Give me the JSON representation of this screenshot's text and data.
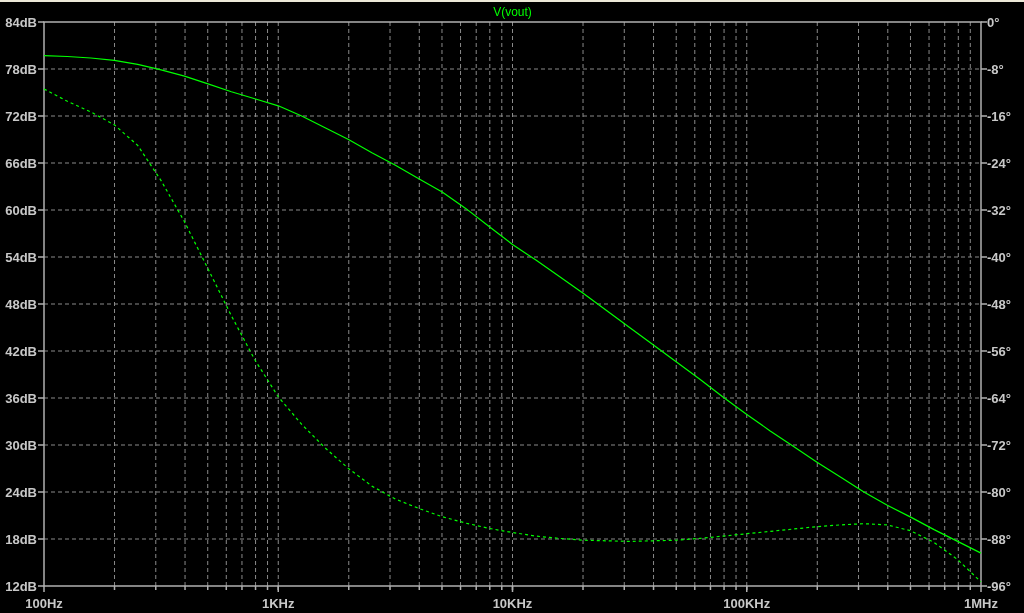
{
  "chart_data": {
    "type": "line",
    "title": "V(vout)",
    "grid": true,
    "categories": [
      "100Hz",
      null,
      null,
      null,
      null,
      null,
      null,
      null,
      null,
      null,
      "1KHz",
      null,
      null,
      null,
      null,
      null,
      null,
      null,
      null,
      null,
      "10KHz",
      null,
      null,
      null,
      null,
      null,
      null,
      null,
      null,
      null,
      "100KHz",
      null,
      null,
      null,
      null,
      null,
      null,
      null,
      null,
      null,
      "1MHz"
    ],
    "series": [
      {
        "color": "#00ff00",
        "line_style": "solid",
        "values": [
          79.7,
          79.6,
          79.4,
          79.1,
          78.6,
          77.9,
          77.1,
          76.1,
          75.1,
          74.2,
          73.3,
          72.0,
          70.5,
          69.0,
          67.3,
          65.7,
          64.0,
          62.3,
          60.2,
          57.9,
          55.6,
          53.6,
          51.5,
          49.4,
          47.2,
          45.0,
          42.8,
          40.6,
          38.4,
          36.1,
          33.9,
          31.8,
          29.8,
          27.8,
          25.9,
          24.0,
          22.3,
          20.8,
          19.2,
          17.7,
          16.2
        ]
      },
      {
        "axis": "y2",
        "color": "#00ff00",
        "line_style": "dashed",
        "values": [
          -11.4,
          -13.5,
          -15.3,
          -17.5,
          -21,
          -27,
          -34,
          -42,
          -50,
          -57.5,
          -63.8,
          -68.5,
          -72.5,
          -76,
          -79,
          -81.2,
          -82.8,
          -84.2,
          -85.3,
          -86.2,
          -86.9,
          -87.5,
          -87.9,
          -88.2,
          -88.3,
          -88.4,
          -88.3,
          -88.2,
          -87.9,
          -87.5,
          -87.1,
          -86.7,
          -86.3,
          -85.9,
          -85.6,
          -85.4,
          -85.6,
          -86.6,
          -88.6,
          -91.5,
          -95.3
        ]
      }
    ],
    "ylim": [
      12,
      84
    ],
    "yticks": [
      {
        "value": 84,
        "label": "84dB"
      },
      {
        "value": 78,
        "label": "78dB"
      },
      {
        "value": 72,
        "label": "72dB"
      },
      {
        "value": 66,
        "label": "66dB"
      },
      {
        "value": 60,
        "label": "60dB"
      },
      {
        "value": 54,
        "label": "54dB"
      },
      {
        "value": 48,
        "label": "48dB"
      },
      {
        "value": 42,
        "label": "42dB"
      },
      {
        "value": 36,
        "label": "36dB"
      },
      {
        "value": 30,
        "label": "30dB"
      },
      {
        "value": 24,
        "label": "24dB"
      },
      {
        "value": 18,
        "label": "18dB"
      },
      {
        "value": 12,
        "label": "12dB"
      }
    ],
    "y2lim": [
      -96,
      0
    ],
    "y2ticks": [
      {
        "value": 0,
        "label": "0°"
      },
      {
        "value": -8,
        "label": "-8°"
      },
      {
        "value": -16,
        "label": "-16°"
      },
      {
        "value": -24,
        "label": "-24°"
      },
      {
        "value": -32,
        "label": "-32°"
      },
      {
        "value": -40,
        "label": "-40°"
      },
      {
        "value": -48,
        "label": "-48°"
      },
      {
        "value": -56,
        "label": "-56°"
      },
      {
        "value": -64,
        "label": "-64°"
      },
      {
        "value": -72,
        "label": "-72°"
      },
      {
        "value": -80,
        "label": "-80°"
      },
      {
        "value": -88,
        "label": "-88°"
      },
      {
        "value": -96,
        "label": "-96°"
      }
    ]
  }
}
